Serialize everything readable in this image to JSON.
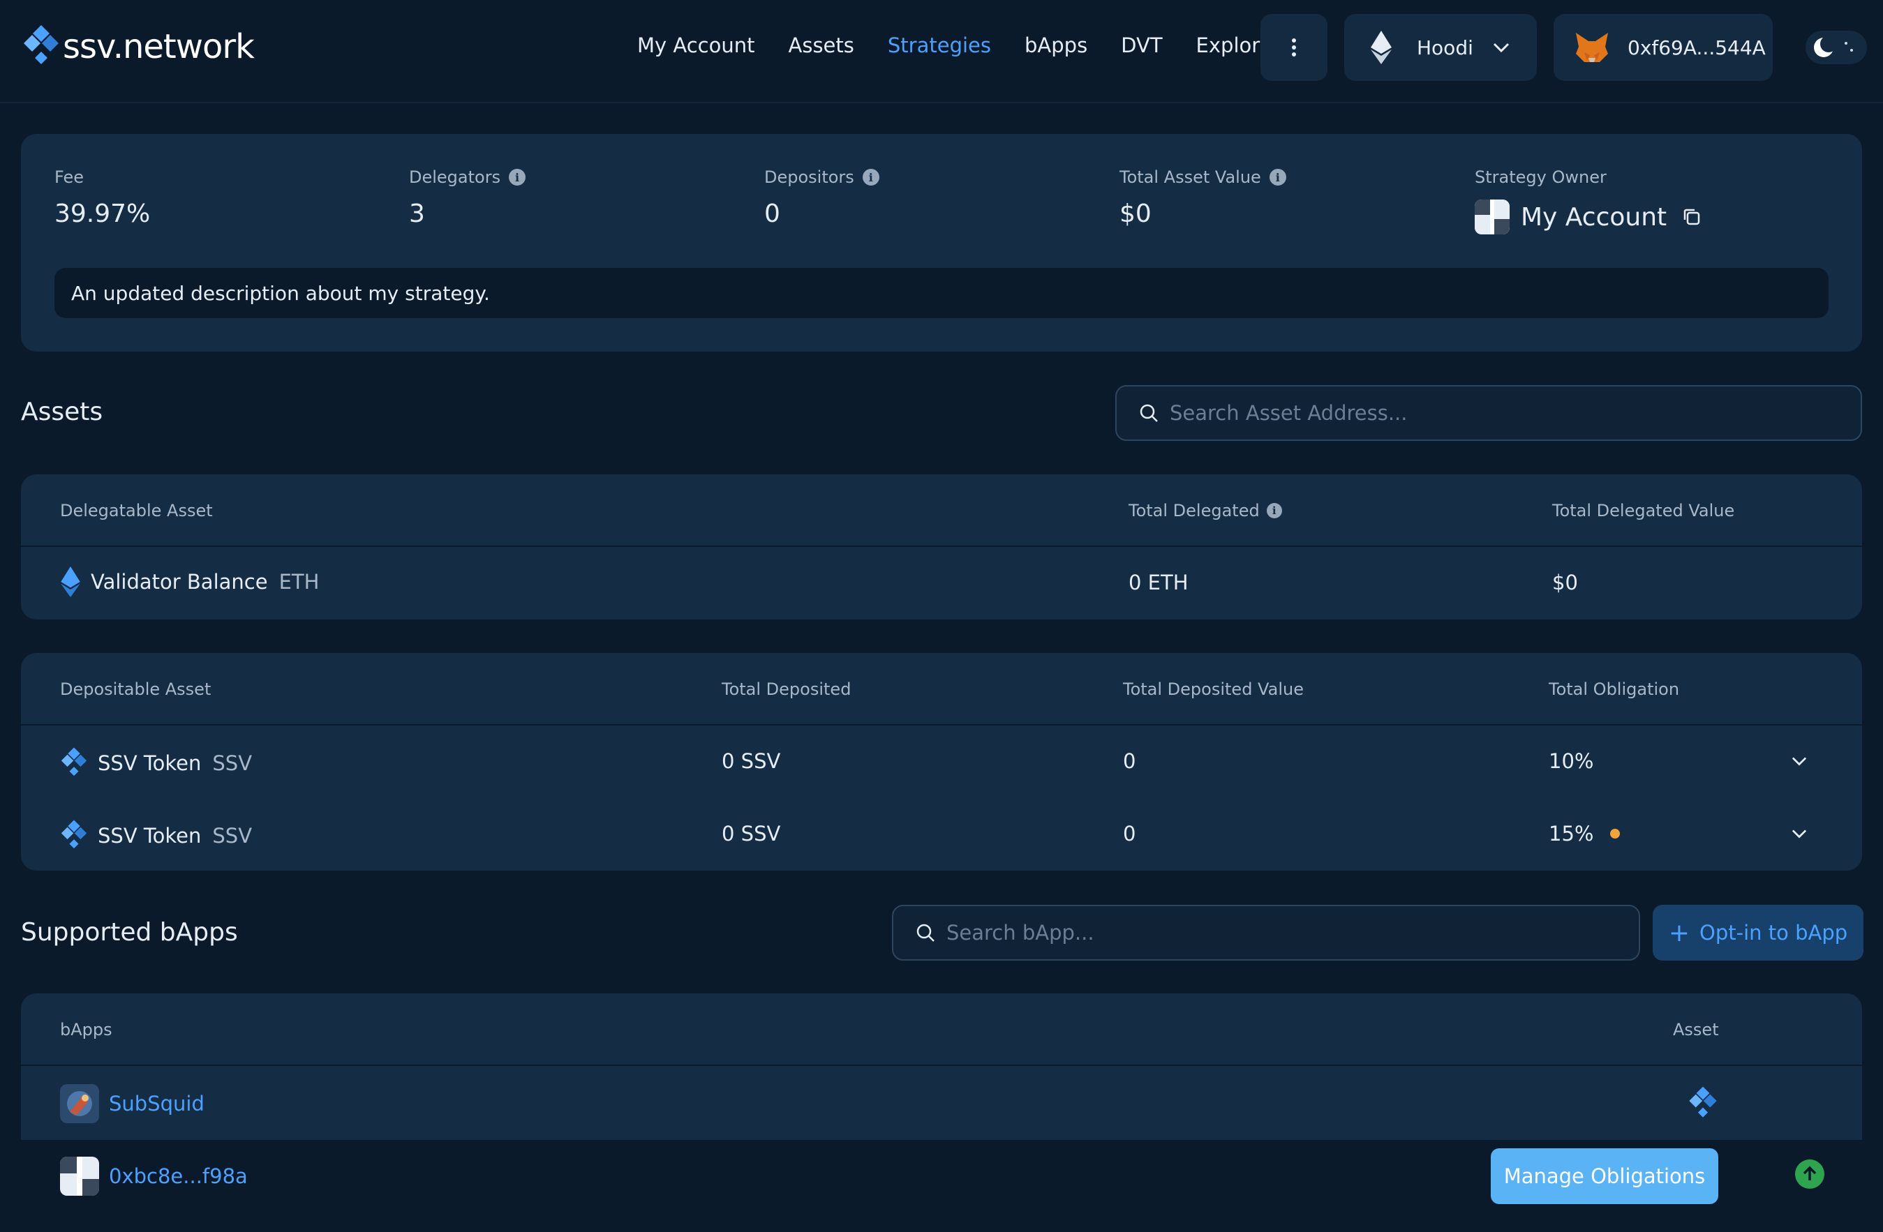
{
  "brand": {
    "name": "ssv.network",
    "accent": "#4aa1ff"
  },
  "nav": {
    "items": [
      "My Account",
      "Assets",
      "Strategies",
      "bApps",
      "DVT",
      "Explorer"
    ],
    "active": "Strategies"
  },
  "network": {
    "label": "Hoodi",
    "icon": "ethereum-icon"
  },
  "wallet": {
    "address": "0xf69A...544A",
    "icon": "metamask-fox-icon"
  },
  "stats": {
    "fee": {
      "label": "Fee",
      "value": "39.97%"
    },
    "delegators": {
      "label": "Delegators",
      "value": "3"
    },
    "depositors": {
      "label": "Depositors",
      "value": "0"
    },
    "total_asset_value": {
      "label": "Total Asset Value",
      "value": "$0"
    },
    "owner": {
      "label": "Strategy Owner",
      "value": "My Account"
    }
  },
  "description": "An updated description about my strategy.",
  "assets": {
    "title": "Assets",
    "search_placeholder": "Search Asset Address...",
    "delegatable": {
      "headers": [
        "Delegatable Asset",
        "Total Delegated",
        "Total Delegated Value"
      ],
      "rows": [
        {
          "name": "Validator Balance",
          "symbol": "ETH",
          "total": "0 ETH",
          "value": "$0"
        }
      ]
    },
    "depositable": {
      "headers": [
        "Depositable Asset",
        "Total Deposited",
        "Total Deposited Value",
        "Total Obligation"
      ],
      "rows": [
        {
          "name": "SSV Token",
          "symbol": "SSV",
          "deposited": "0 SSV",
          "value": "0",
          "obligation": "10%",
          "pending": false
        },
        {
          "name": "SSV Token",
          "symbol": "SSV",
          "deposited": "0 SSV",
          "value": "0",
          "obligation": "15%",
          "pending": true
        }
      ]
    }
  },
  "bapps": {
    "title": "Supported bApps",
    "search_placeholder": "Search bApp...",
    "optin_label": "Opt-in to bApp",
    "headers": [
      "bApps",
      "Asset"
    ],
    "rows": [
      {
        "name": "SubSquid",
        "asset_icon": "ssv-icon"
      },
      {
        "name": "0xbc8e...f98a"
      }
    ],
    "manage_label": "Manage Obligations"
  },
  "colors": {
    "pending_dot": "#f2a33a",
    "scroll_top": "#2ea44f",
    "manage_button": "#5ab3f5"
  }
}
